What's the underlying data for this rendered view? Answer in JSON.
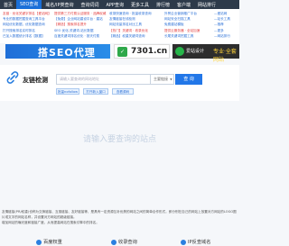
{
  "topnav": {
    "items": [
      "首页",
      "SEO查询",
      "域名/IP类查询",
      "查询词词",
      "APP查询",
      "更多工具",
      "排行榜",
      "客户端",
      "网站排行"
    ],
    "active_index": 1
  },
  "ads": {
    "col1": [
      "友链 · 优化关键字排名【爱站网】",
      "专业的数据挖掘查询工具平台",
      "网站优化数据，优化数据查询",
      "打开搜索排名实时排名",
      "已加入数据统计排名【数据】"
    ],
    "col2": [
      "提供第三方付费认证服务 · 品牌权威",
      "【免费】企业网站建设平台 · 建站",
      "【精选】搜索排名提升",
      "SEO 优化-关键词-站长数据",
      "百度关键词排名优化 · 按天付费"
    ],
    "col3": [
      "收录快速查询 · 批量收录查询",
      "友情链接在线检测",
      "网站流量排名对比工具",
      "【热门】关键词 · 收录优化",
      "【精品】权重关键词查询"
    ],
    "col4": [
      "外贸企业营销推广平台",
      "网站安全扫描工具",
      "免费建站模板",
      "提供云服务器 · 全站加速",
      "长尾关键词挖掘工具"
    ],
    "col5": [
      "—爱站网",
      "—站长工具",
      "—推荐",
      "—更多",
      "—网站排行"
    ]
  },
  "banners": {
    "b1_text": "搭SEO代理",
    "b2_text": "7301.cn",
    "b3_text1": "爱站设计",
    "b3_text2": "专业·全套网站"
  },
  "tool": {
    "title": "友链检测",
    "search_placeholder": "请输入要查询的网站地址",
    "select_value": "主要链接",
    "search_button": "查 询",
    "sub_buttons": [
      "批量nofollow",
      "打开新入窗口",
      "查看源码"
    ]
  },
  "empty_message": "请输入要查询的站点",
  "description": [
    "友情链接(PR/权重)也称为交换链接、互惠链接、友好链接等，是具有一定资源互补优势的网站之间的简单合作形式，即分别在自己的网站上放置对方网站的LOGO图片或文字的网站名称，并设置对方网站的超级链接。",
    "增加网站的曝光度和链接广度，从而提高网站在搜索引擎中的排名。"
  ],
  "bottom": {
    "items": [
      "百度权重",
      "收录查询",
      "IP反查域名"
    ]
  },
  "colors": {
    "topnav_bg": "#2d3a4a",
    "accent": "#2277e8"
  }
}
